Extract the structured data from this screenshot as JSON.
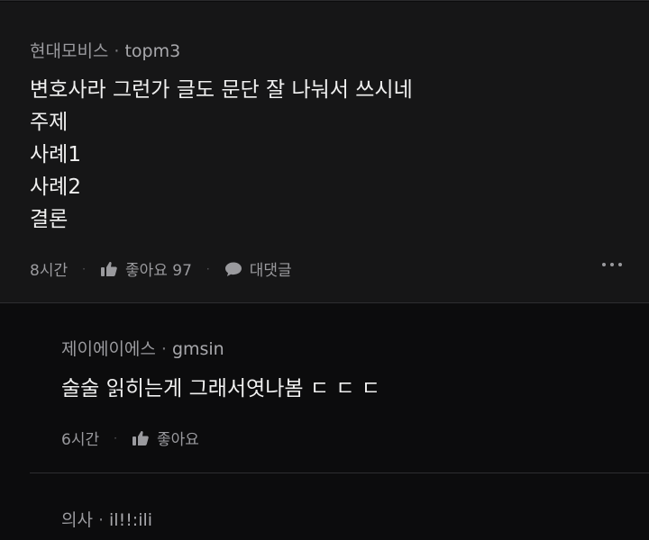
{
  "comment": {
    "company": "현대모비스",
    "separator": "·",
    "nickname": "topm3",
    "lines": [
      "변호사라 그런가 글도 문단 잘 나눠서 쓰시네",
      "주제",
      "사례1",
      "사례2",
      "결론"
    ],
    "time": "8시간",
    "like_label": "좋아요 97",
    "reply_label": "대댓글",
    "icons": {
      "like": "thumbs-up-icon",
      "reply": "speech-bubble-icon",
      "more": "more-dots-icon"
    }
  },
  "replies": [
    {
      "company": "제이에이에스",
      "separator": "·",
      "nickname": "gmsin",
      "text": "술술 읽히는게 그래서엿나봄 ㄷ ㄷ ㄷ",
      "time": "6시간",
      "like_label": "좋아요"
    },
    {
      "company": "의사",
      "separator": "·",
      "nickname": "il!!:ili"
    }
  ]
}
